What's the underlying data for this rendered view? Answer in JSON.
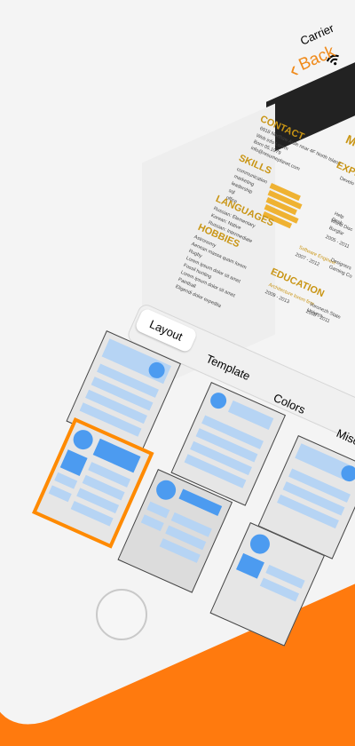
{
  "status_bar": {
    "carrier": "Carrier"
  },
  "nav": {
    "back_label": "Back"
  },
  "resume": {
    "header_initial": "M",
    "contact_title": "CONTACT",
    "contact_lines": [
      "6918 Northaw Aisle near 4F North Island",
      "Web info Lorem",
      "Born 05.1979",
      "info@resumeplanet.com"
    ],
    "skills_title": "SKILLS",
    "skills": [
      "communication",
      "marketing",
      "leadership",
      "sql",
      "office"
    ],
    "languages_title": "LANGUAGES",
    "languages": [
      "Russian: Elementary",
      "Korean: Native",
      "Russian: Intermediate"
    ],
    "hobbies_title": "HOBBIES",
    "hobbies": [
      "Astronomy",
      "Aenean massa quam lorem",
      "Rugby",
      "Lorem ipsum dolor sit amet",
      "Fossil hunting",
      "Lorem ipsum dolor sit amet",
      "Paintball",
      "Eligendi dolor expedita"
    ],
    "experience_title": "EXPE",
    "experience_lines": [
      "Develo",
      "Help Desk",
      "World Disc",
      "Burglar",
      "2005 - 2011",
      "Software Engineer",
      "2007 - 2012",
      "Designers",
      "Gaming Co"
    ],
    "education_title": "EDUCATION",
    "education_lines": [
      "Architecture lorem firm",
      "2009 - 2013",
      "Voronezh State Univers",
      "2008 - 2011"
    ]
  },
  "tabs": [
    {
      "label": "Layout",
      "active": true
    },
    {
      "label": "Template",
      "active": false
    },
    {
      "label": "Colors",
      "active": false
    },
    {
      "label": "Misc",
      "active": false
    }
  ],
  "colors": {
    "accent": "#ff8a00",
    "back": "#f08a1a",
    "tile_blue": "#4c9bf0",
    "tile_light": "#b6d4f4"
  }
}
